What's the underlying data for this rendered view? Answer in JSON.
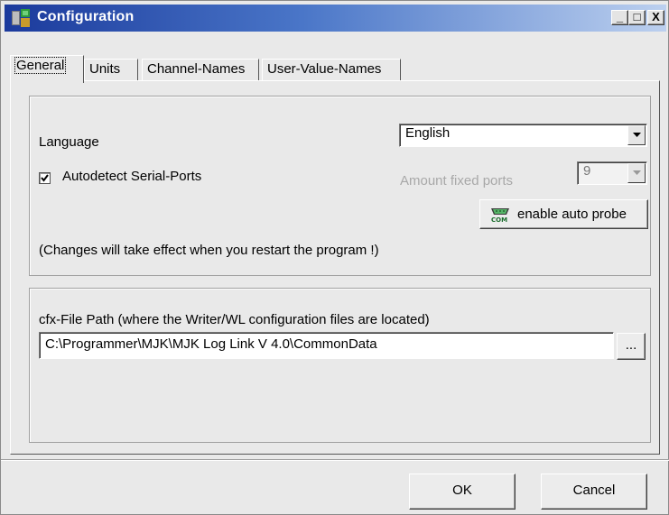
{
  "window": {
    "title": "Configuration",
    "minimize_label": "_",
    "maximize_label": "□",
    "close_label": "X"
  },
  "tabs": [
    {
      "label": "General",
      "active": true
    },
    {
      "label": "Units",
      "active": false
    },
    {
      "label": "Channel-Names",
      "active": false
    },
    {
      "label": "User-Value-Names",
      "active": false
    }
  ],
  "general": {
    "language_label": "Language",
    "language_value": "English",
    "autodetect_label": "Autodetect Serial-Ports",
    "autodetect_checked": true,
    "amount_fixed_ports_label": "Amount fixed ports",
    "amount_fixed_ports_value": "9",
    "auto_probe_button": "enable auto probe",
    "auto_probe_icon": "com-port-icon",
    "restart_note": "(Changes will take effect when you restart the program !)",
    "cfx_path_label": "cfx-File Path (where the Writer/WL configuration files are located)",
    "cfx_path_value": "C:\\Programmer\\MJK\\MJK Log Link V 4.0\\CommonData",
    "browse_button": "..."
  },
  "footer": {
    "ok_label": "OK",
    "cancel_label": "Cancel"
  },
  "colors": {
    "titlebar_start": "#1b3a9c",
    "titlebar_end": "#bcd0ef",
    "dialog_bg": "#e9e9e9",
    "disabled_text": "#a8a8a8"
  }
}
